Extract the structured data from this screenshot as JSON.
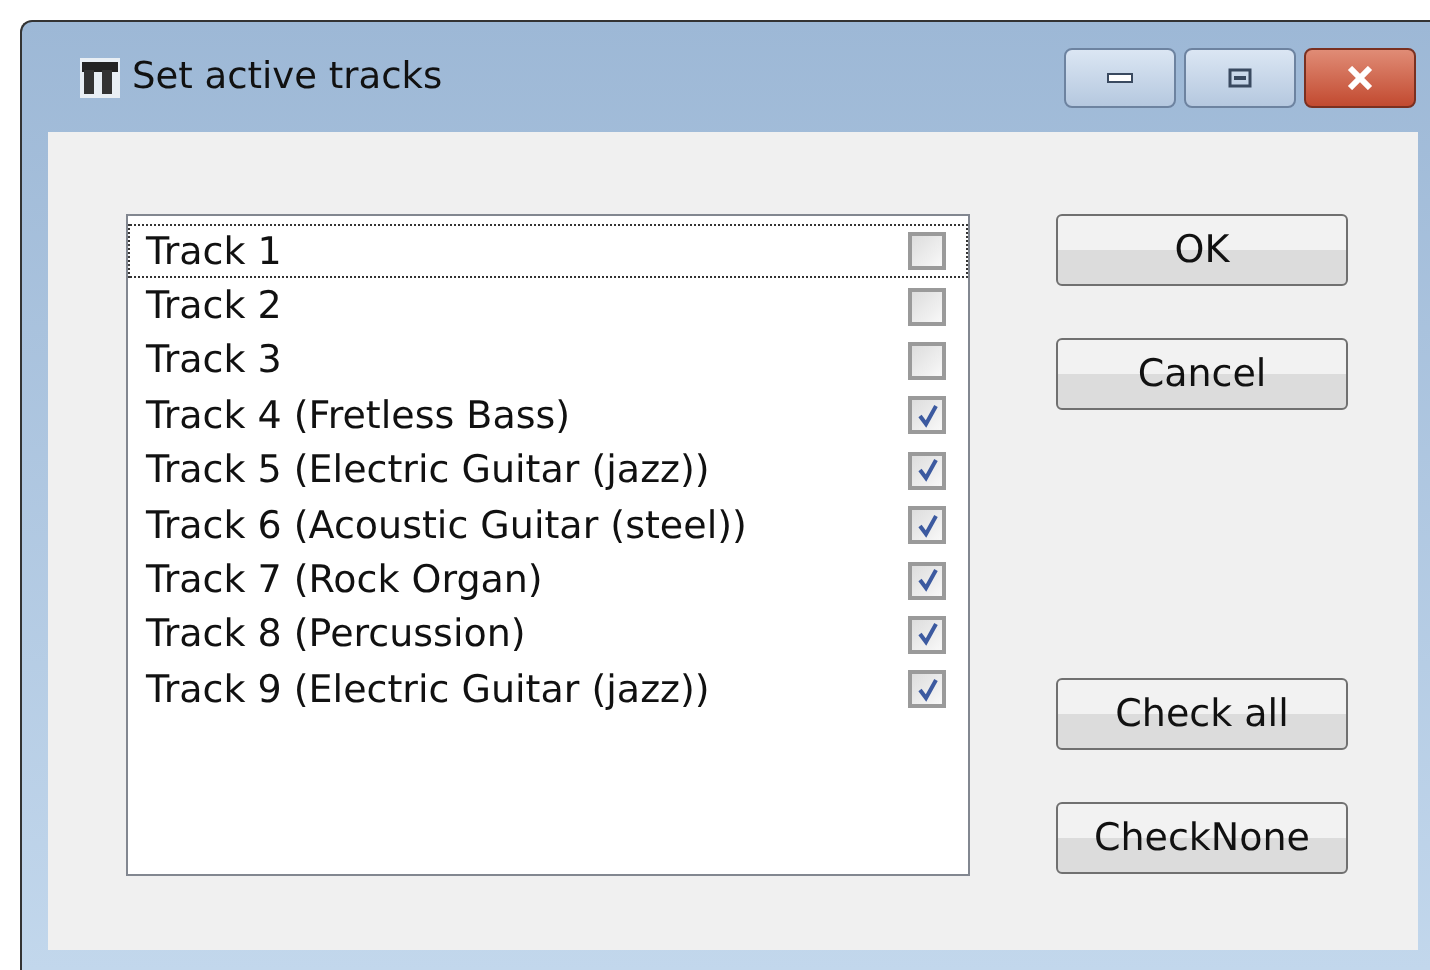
{
  "window": {
    "title": "Set active tracks"
  },
  "tracks": [
    {
      "label": "Track 1",
      "checked": false,
      "focused": true
    },
    {
      "label": "Track 2",
      "checked": false,
      "focused": false
    },
    {
      "label": "Track 3",
      "checked": false,
      "focused": false
    },
    {
      "label": "Track 4 (Fretless Bass)",
      "checked": true,
      "focused": false
    },
    {
      "label": "Track 5 (Electric Guitar (jazz))",
      "checked": true,
      "focused": false
    },
    {
      "label": "Track 6 (Acoustic Guitar (steel))",
      "checked": true,
      "focused": false
    },
    {
      "label": "Track 7 (Rock Organ)",
      "checked": true,
      "focused": false
    },
    {
      "label": "Track 8 (Percussion)",
      "checked": true,
      "focused": false
    },
    {
      "label": "Track 9 (Electric Guitar (jazz))",
      "checked": true,
      "focused": false
    }
  ],
  "buttons_top": [
    "OK",
    "Cancel"
  ],
  "buttons_bottom": [
    "Check all",
    "CheckNone"
  ]
}
